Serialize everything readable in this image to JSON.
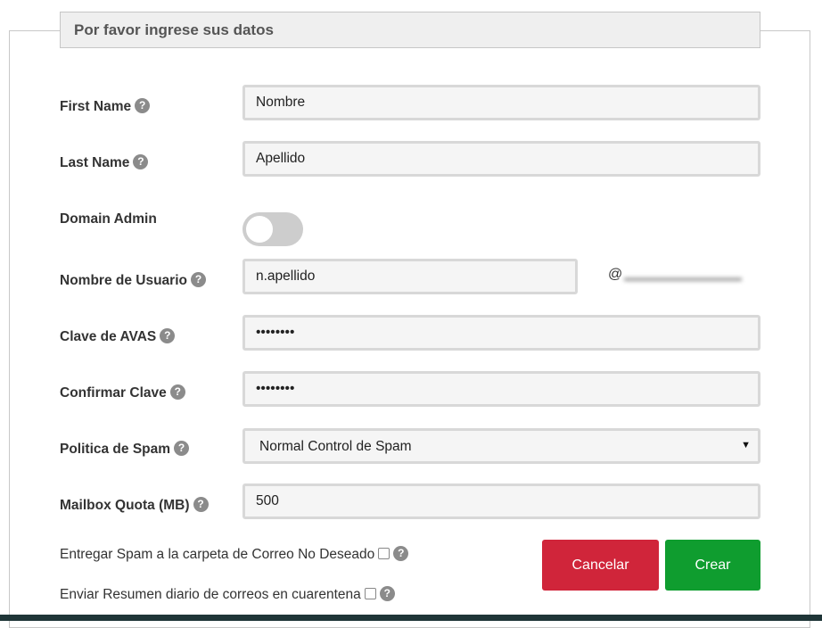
{
  "form": {
    "legend": "Por favor ingrese sus datos",
    "help_glyph": "?",
    "fields": {
      "first_name": {
        "label": "First Name",
        "value": "Nombre"
      },
      "last_name": {
        "label": "Last Name",
        "value": "Apellido"
      },
      "domain_admin": {
        "label": "Domain Admin",
        "enabled": false
      },
      "username": {
        "label": "Nombre de Usuario",
        "value": "n.apellido",
        "at": "@"
      },
      "password": {
        "label": "Clave de AVAS",
        "value": "••••••••"
      },
      "confirm_password": {
        "label": "Confirmar Clave",
        "value": "••••••••"
      },
      "spam_policy": {
        "label": "Politica de Spam",
        "selected": "Normal Control de Spam",
        "caret": "▼"
      },
      "mailbox_quota": {
        "label": "Mailbox Quota (MB)",
        "value": "500"
      }
    },
    "options": {
      "deliver_spam": {
        "label": "Entregar Spam a la carpeta de Correo No Deseado",
        "checked": false
      },
      "daily_digest": {
        "label": "Enviar Resumen diario de correos en cuarentena",
        "checked": false
      }
    },
    "buttons": {
      "cancel": "Cancelar",
      "create": "Crear"
    }
  },
  "colors": {
    "cancel": "#d0253a",
    "create": "#0f9d2f",
    "toggle_off": "#cdcdcd",
    "help_icon": "#8b8b8b",
    "bottom_bar": "#1f3537"
  },
  "icons": {
    "help": "question-circle-icon",
    "select_caret": "caret-down-icon"
  }
}
